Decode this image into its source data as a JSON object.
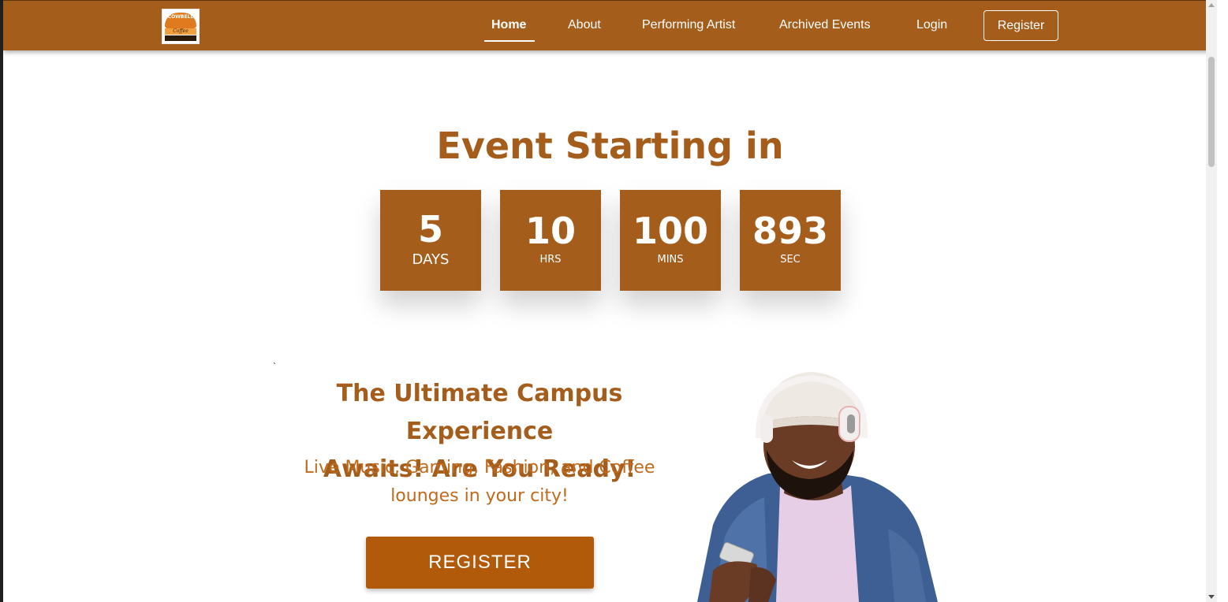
{
  "nav": {
    "logo_alt": "Cowbell Coffee",
    "logo_top_text": "COWBELL",
    "logo_mid_text": "Coffee",
    "links": [
      {
        "label": "Home",
        "active": true
      },
      {
        "label": "About",
        "active": false
      },
      {
        "label": "Performing Artist",
        "active": false
      },
      {
        "label": "Archived Events",
        "active": false
      },
      {
        "label": "Login",
        "active": false
      }
    ],
    "register_label": "Register"
  },
  "countdown": {
    "title": "Event Starting in",
    "units": [
      {
        "value": "5",
        "label": "DAYS"
      },
      {
        "value": "10",
        "label": "HRS"
      },
      {
        "value": "100",
        "label": "MINS"
      },
      {
        "value": "893",
        "label": "SEC"
      }
    ]
  },
  "hero": {
    "tick": "`",
    "heading_line1": "The Ultimate Campus Experience",
    "heading_line2": "Awaits! Are You Ready!",
    "sub_line1": "Live Music, Gaming, Fashion, and Coffee",
    "sub_line2": "lounges in your city!",
    "register_label": "REGISTER",
    "image_icon": "smiling-man-with-headphones-and-phone"
  },
  "colors": {
    "brand": "#a55d1c",
    "button": "#b05a0a",
    "subtext": "#c06a1e"
  }
}
